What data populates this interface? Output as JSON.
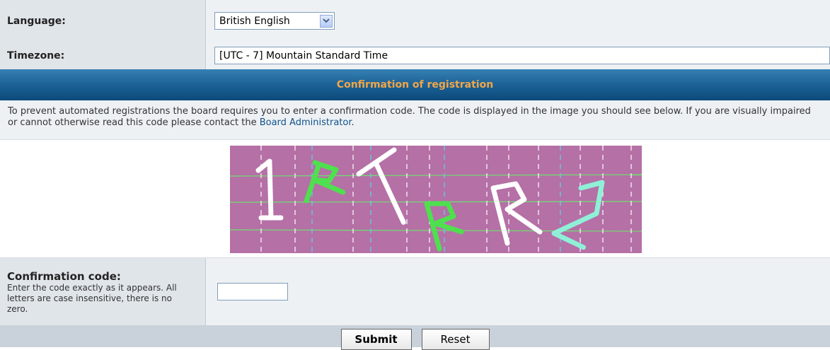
{
  "form": {
    "language": {
      "label": "Language:",
      "value": "British English"
    },
    "timezone": {
      "label": "Timezone:",
      "value": "[UTC - 7] Mountain Standard Time"
    }
  },
  "confirmation": {
    "header": "Confirmation of registration",
    "text_before": "To prevent automated registrations the board requires you to enter a confirmation code. The code is displayed in the image you should see below. If you are visually impaired or cannot otherwise read this code please contact the ",
    "link": "Board Administrator",
    "text_after": ".",
    "code_label": "Confirmation code:",
    "code_hint": "Enter the code exactly as it appears. All letters are case insensitive, there is no zero.",
    "code_value": ""
  },
  "captcha": {
    "characters": [
      "1",
      "R",
      "T",
      "R",
      "R",
      "2"
    ]
  },
  "buttons": {
    "submit": "Submit",
    "reset": "Reset"
  },
  "colors": {
    "header_bg": "#1a5f93",
    "header_text": "#f1a64a",
    "link": "#105289",
    "captcha_bg": "#b570a6"
  }
}
